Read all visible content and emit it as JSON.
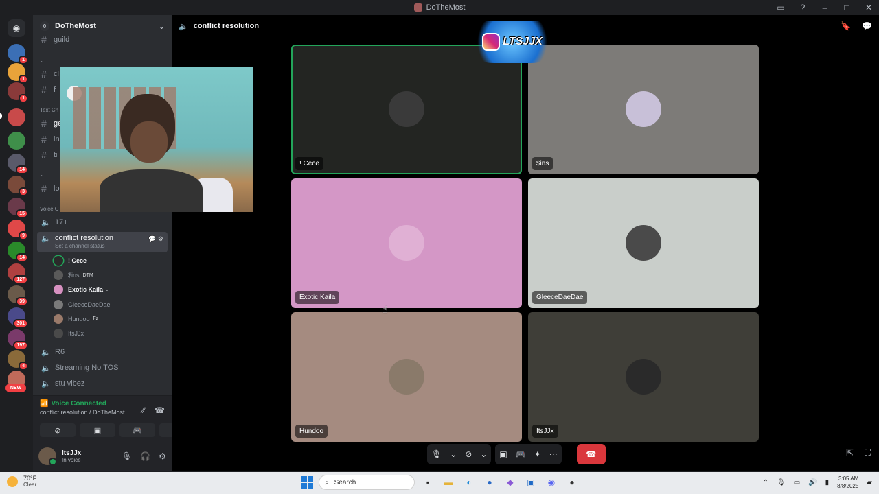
{
  "window": {
    "title": "DoTheMost"
  },
  "server": {
    "name": "DoTheMost",
    "count": "0"
  },
  "servers": [
    {
      "color": "#3b6fb5",
      "badge": "1"
    },
    {
      "color": "#e8a33a",
      "badge": "1"
    },
    {
      "color": "#8a3a3a",
      "badge": "1"
    },
    {
      "color": "#c84a4a",
      "badge": ""
    },
    {
      "color": "#3f8f4a",
      "badge": ""
    },
    {
      "color": "#5a5a6a",
      "badge": "14"
    },
    {
      "color": "#7a4a3a",
      "badge": "3"
    },
    {
      "color": "#6a3a4a",
      "badge": "15"
    },
    {
      "color": "#e04848",
      "badge": "9"
    },
    {
      "color": "#2a8a2a",
      "badge": "14"
    },
    {
      "color": "#b04040",
      "badge": "127"
    },
    {
      "color": "#6a5a4a",
      "badge": "39"
    },
    {
      "color": "#4a4a8a",
      "badge": "301"
    },
    {
      "color": "#7a3a6a",
      "badge": "197"
    },
    {
      "color": "#8a6a3a",
      "badge": "4"
    },
    {
      "color": "#c06a5a",
      "badge": ""
    }
  ],
  "new_badge": "NEW",
  "channels": {
    "guild": "guild",
    "c1": "cl",
    "c2": "f",
    "text_category": "Text Ch",
    "c3": "ge",
    "c4": "in",
    "c5": "ti",
    "c6": "lo",
    "voice_category": "Voice C",
    "v1": "17+",
    "active": "conflict resolution",
    "active_status": "Set a channel status",
    "v3": "R6",
    "v4": "Streaming No TOS",
    "v5": "stu vibez"
  },
  "voice_users": [
    {
      "name": "! Cece",
      "tag": "",
      "color": "#2a2a2a",
      "speaking": true,
      "bright": true
    },
    {
      "name": "$ins",
      "tag": "DTM",
      "color": "#5a5a5a",
      "speaking": false,
      "bright": false
    },
    {
      "name": "Exotic Kaila",
      "tag": ".",
      "color": "#d690c0",
      "speaking": false,
      "bright": true
    },
    {
      "name": "GleeceDaeDae",
      "tag": "",
      "color": "#7a7a7a",
      "speaking": false,
      "bright": false
    },
    {
      "name": "Hundoo",
      "tag": "Fz",
      "color": "#9a7a6a",
      "speaking": false,
      "bright": false
    },
    {
      "name": "ItsJJx",
      "tag": "",
      "color": "#4a4a4a",
      "speaking": false,
      "bright": false
    }
  ],
  "voice_panel": {
    "title": "Voice Connected",
    "subtitle": "conflict resolution / DoTheMost"
  },
  "user": {
    "name": "ItsJJx",
    "status": "In voice"
  },
  "main": {
    "channel": "conflict resolution",
    "overlay_text": "LTSJJX"
  },
  "tiles": [
    {
      "label": "! Cece",
      "bg": "#232522",
      "avatar": "#3a3a3a"
    },
    {
      "label": "$ins",
      "bg": "#7d7b78",
      "avatar": "#c8c0d8"
    },
    {
      "label": "Exotic Kaila",
      "bg": "#d497c6",
      "avatar": "#e0b0d4"
    },
    {
      "label": "GleeceDaeDae",
      "bg": "#c9ceca",
      "avatar": "#4a4a4a"
    },
    {
      "label": "Hundoo",
      "bg": "#a58b80",
      "avatar": "#8a7a6a"
    },
    {
      "label": "ItsJJx",
      "bg": "#3f3e38",
      "avatar": "#2a2a2a"
    }
  ],
  "taskbar": {
    "temp": "70°F",
    "weather": "Clear",
    "search": "Search",
    "time": "3:05 AM",
    "date": "8/8/2025"
  }
}
